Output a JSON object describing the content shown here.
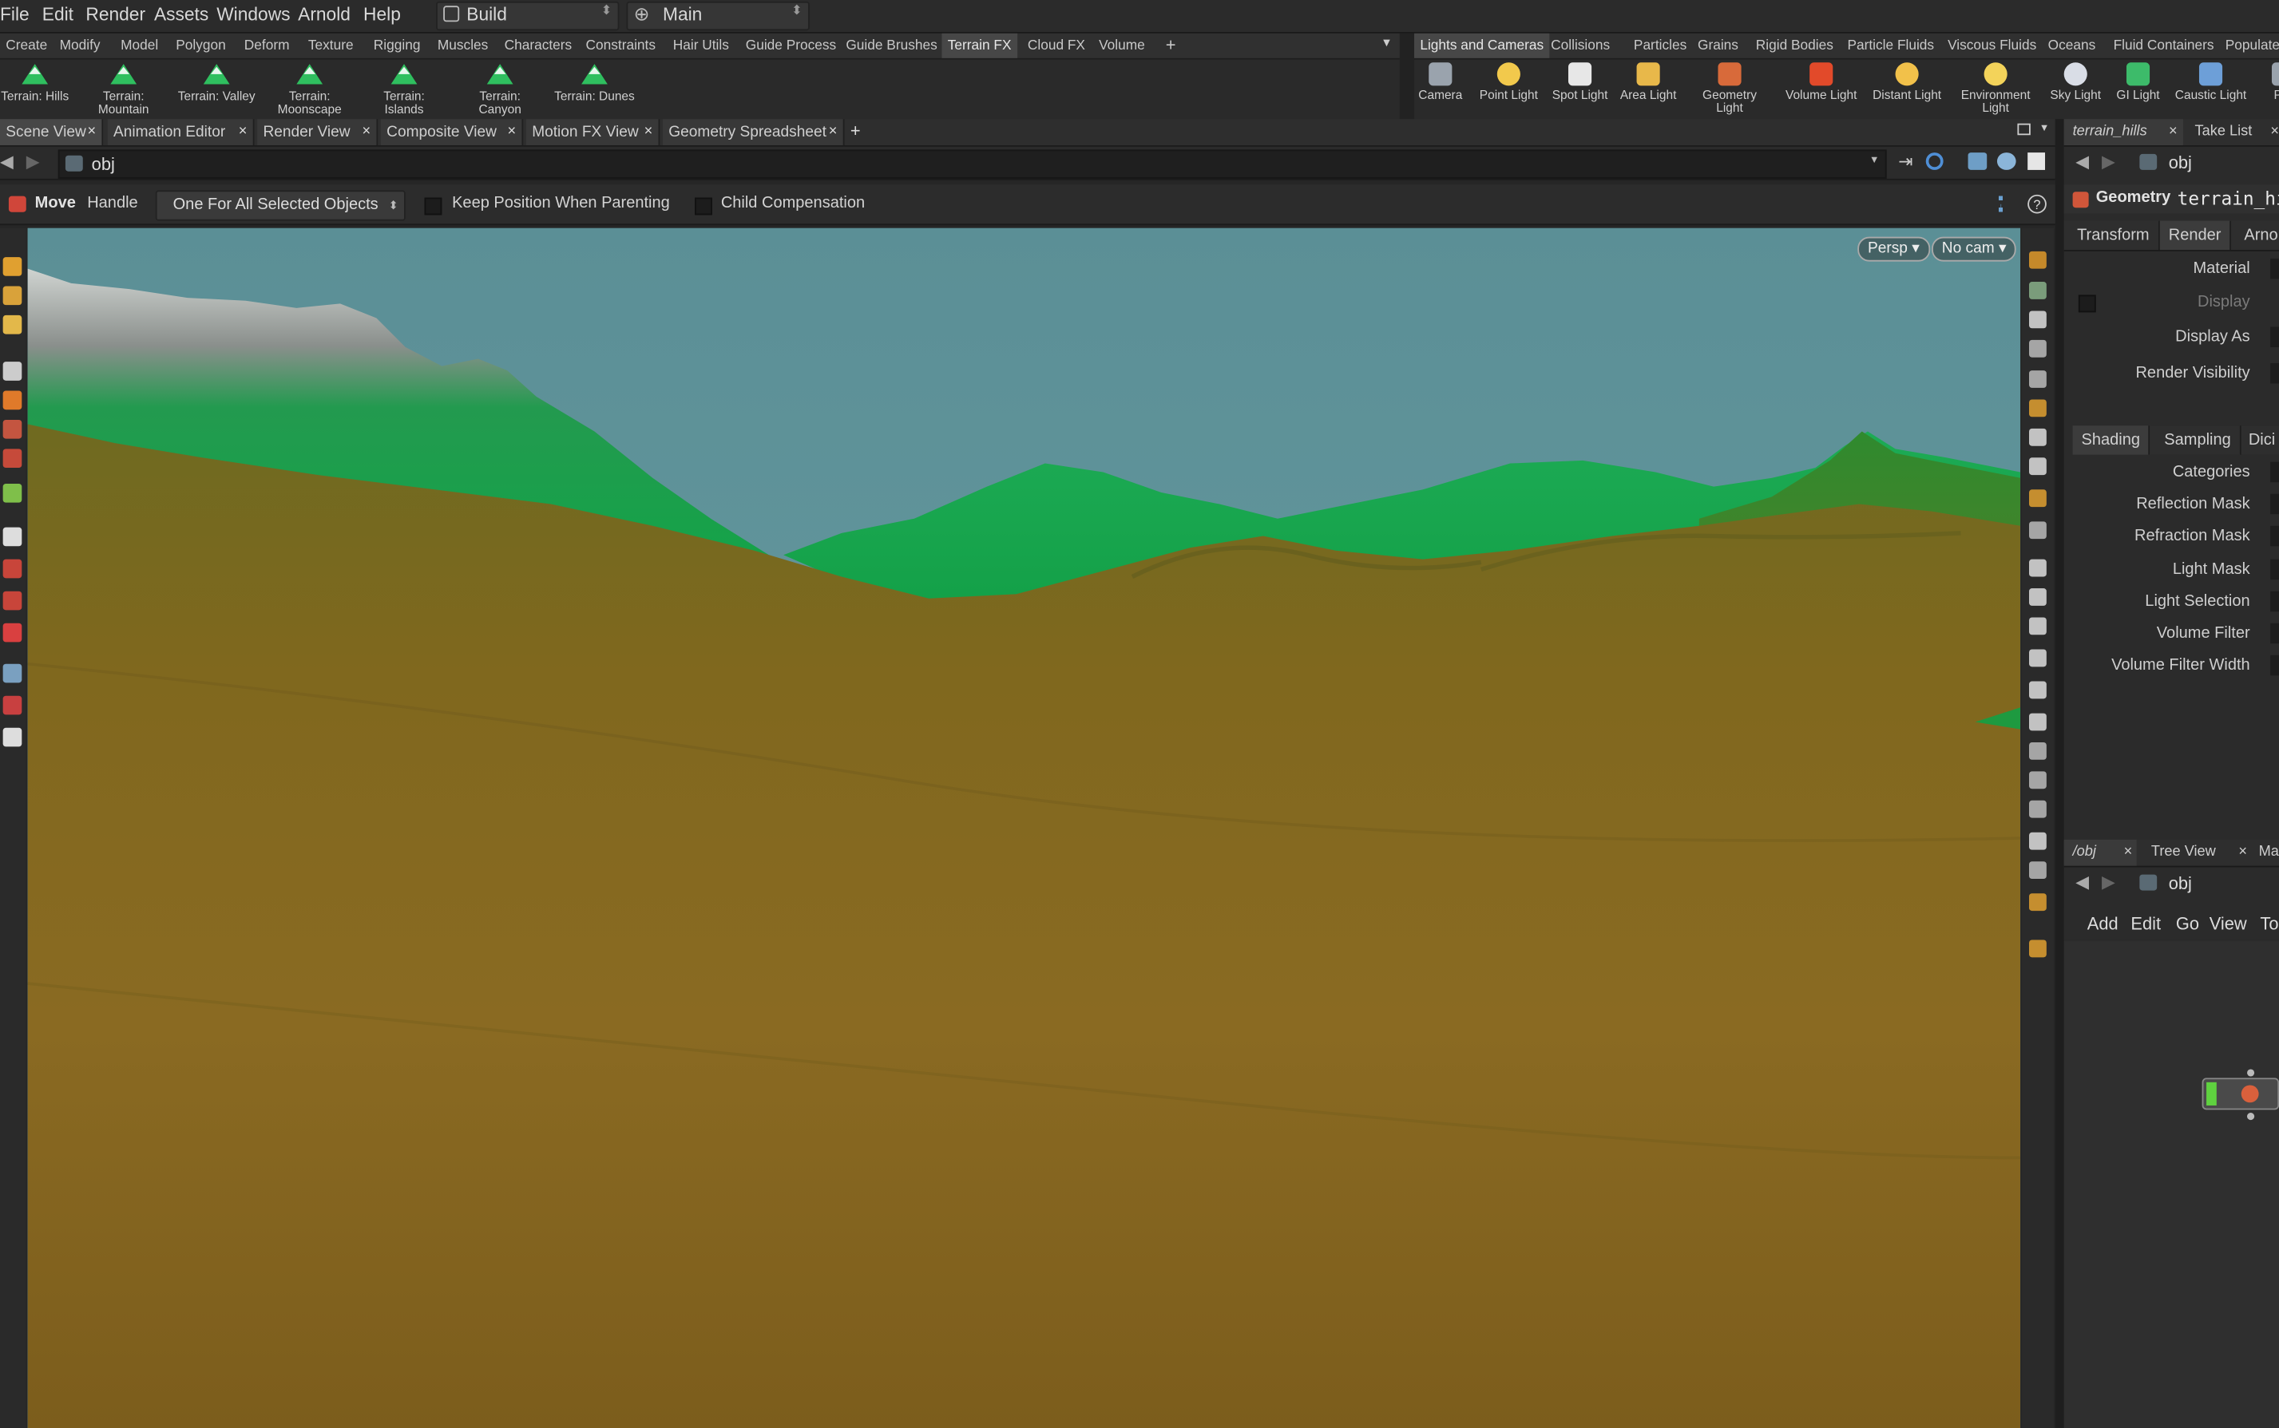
{
  "menubar": {
    "items": [
      "File",
      "Edit",
      "Render",
      "Assets",
      "Windows",
      "Arnold",
      "Help"
    ],
    "desktop_label": "Build",
    "context_label": "Main"
  },
  "shelf_left": {
    "tabs": [
      "Create",
      "Modify",
      "Model",
      "Polygon",
      "Deform",
      "Texture",
      "Rigging",
      "Muscles",
      "Characters",
      "Constraints",
      "Hair Utils",
      "Guide Process",
      "Guide Brushes",
      "Terrain FX",
      "Cloud FX",
      "Volume"
    ],
    "active_tab": "Terrain FX",
    "add_tab": "+",
    "tools": [
      {
        "line1": "Terrain: Hills",
        "line2": "",
        "icon": "terrain-icon"
      },
      {
        "line1": "Terrain:",
        "line2": "Mountain",
        "icon": "terrain-icon"
      },
      {
        "line1": "Terrain: Valley",
        "line2": "",
        "icon": "terrain-icon"
      },
      {
        "line1": "Terrain:",
        "line2": "Moonscape",
        "icon": "terrain-icon"
      },
      {
        "line1": "Terrain:",
        "line2": "Islands",
        "icon": "terrain-icon"
      },
      {
        "line1": "Terrain:",
        "line2": "Canyon",
        "icon": "terrain-icon"
      },
      {
        "line1": "Terrain: Dunes",
        "line2": "",
        "icon": "terrain-icon"
      }
    ]
  },
  "shelf_right": {
    "tabs": [
      "Lights and Cameras",
      "Collisions",
      "Particles",
      "Grains",
      "Rigid Bodies",
      "Particle Fluids",
      "Viscous Fluids",
      "Oceans",
      "Fluid Containers",
      "Populate"
    ],
    "active_tab": "Lights and Cameras",
    "tools": [
      {
        "line1": "Camera",
        "line2": "",
        "icon": "camera-icon",
        "color": "#9aa3ad"
      },
      {
        "line1": "Point Light",
        "line2": "",
        "icon": "point-light-icon",
        "color": "#f2c94c"
      },
      {
        "line1": "Spot Light",
        "line2": "",
        "icon": "spot-light-icon",
        "color": "#e7e7e7"
      },
      {
        "line1": "Area Light",
        "line2": "",
        "icon": "area-light-icon",
        "color": "#e8b84a"
      },
      {
        "line1": "Geometry",
        "line2": "Light",
        "icon": "geometry-light-icon",
        "color": "#d86a3a"
      },
      {
        "line1": "Volume Light",
        "line2": "",
        "icon": "volume-light-icon",
        "color": "#e24a2a"
      },
      {
        "line1": "Distant Light",
        "line2": "",
        "icon": "distant-light-icon",
        "color": "#f2c14a"
      },
      {
        "line1": "Environment",
        "line2": "Light",
        "icon": "environment-light-icon",
        "color": "#f3d35a"
      },
      {
        "line1": "Sky Light",
        "line2": "",
        "icon": "sky-light-icon",
        "color": "#d9dde6"
      },
      {
        "line1": "GI Light",
        "line2": "",
        "icon": "gi-light-icon",
        "color": "#3dbb6a"
      },
      {
        "line1": "Caustic Light",
        "line2": "",
        "icon": "caustic-light-icon",
        "color": "#6d9fd8"
      },
      {
        "line1": "Por",
        "line2": "",
        "icon": "portal-light-icon",
        "color": "#9aa3ad"
      }
    ]
  },
  "pane_tabs": [
    {
      "label": "Scene View",
      "close": "×"
    },
    {
      "label": "Animation Editor",
      "close": "×"
    },
    {
      "label": "Render View",
      "close": "×"
    },
    {
      "label": "Composite View",
      "close": "×"
    },
    {
      "label": "Motion FX View",
      "close": "×"
    },
    {
      "label": "Geometry Spreadsheet",
      "close": "×"
    }
  ],
  "pane_add": "+",
  "path": {
    "value": "obj"
  },
  "operation_bar": {
    "tool_label": "Move",
    "handle_label": "Handle",
    "mode_value": "One For All Selected Objects",
    "keep_position_label": "Keep Position When Parenting",
    "child_comp_label": "Child Compensation"
  },
  "viewport": {
    "camera_label": "Persp ▾",
    "cam_label": "No cam ▾",
    "sky_color": "#5f9298",
    "ground_color": "#8a6a22",
    "hills_color": "#14a84c"
  },
  "right_panel": {
    "top_tabs": [
      {
        "label": "terrain_hills",
        "close": "×"
      },
      {
        "label": "Take List",
        "close": "×"
      }
    ],
    "path": "obj",
    "node_type": "Geometry",
    "node_name": "terrain_hi",
    "param_tabs": [
      "Transform",
      "Render",
      "Arno"
    ],
    "params": [
      {
        "label": "Material",
        "dim": false
      },
      {
        "label": "Display",
        "dim": true
      },
      {
        "label": "Display As",
        "dim": false
      },
      {
        "label": "Render Visibility",
        "dim": false
      }
    ],
    "sub_tabs": [
      "Shading",
      "Sampling",
      "Dici"
    ],
    "shading_params": [
      "Categories",
      "Reflection Mask",
      "Refraction Mask",
      "Light Mask",
      "Light Selection",
      "Volume Filter",
      "Volume Filter Width"
    ],
    "network_tabs": [
      {
        "label": "/obj",
        "close": "×"
      },
      {
        "label": "Tree View",
        "close": "×"
      },
      {
        "label": "Ma",
        "close": ""
      }
    ],
    "network_path": "obj",
    "network_menu": [
      "Add",
      "Edit",
      "Go",
      "View",
      "To"
    ]
  }
}
